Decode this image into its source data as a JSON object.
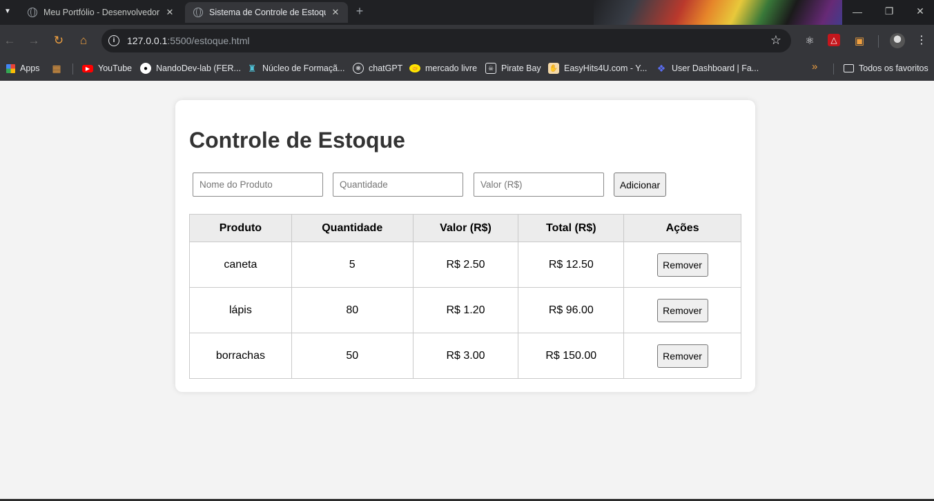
{
  "browser": {
    "tabs": [
      {
        "title": "Meu Portfólio - Desenvolvedor",
        "active": false
      },
      {
        "title": "Sistema de Controle de Estoque",
        "active": true
      }
    ],
    "url_host": "127.0.0.1",
    "url_rest": ":5500/estoque.html",
    "bookmarks": [
      {
        "label": "Apps",
        "icon": "apps-grid-icon"
      },
      {
        "label": "YouTube",
        "icon": "youtube-icon"
      },
      {
        "label": "NandoDev-lab (FER...",
        "icon": "github-icon"
      },
      {
        "label": "Núcleo de Formaçã...",
        "icon": "nucleo-icon"
      },
      {
        "label": "chatGPT",
        "icon": "chatgpt-icon"
      },
      {
        "label": "mercado livre",
        "icon": "mercadolivre-icon"
      },
      {
        "label": "Pirate Bay",
        "icon": "piratebay-icon"
      },
      {
        "label": "EasyHits4U.com - Y...",
        "icon": "easyhits-icon"
      },
      {
        "label": "User Dashboard | Fa...",
        "icon": "dashboard-icon"
      }
    ],
    "other_bookmarks": "Todos os favoritos"
  },
  "page": {
    "title": "Controle de Estoque",
    "form": {
      "name_placeholder": "Nome do Produto",
      "qty_placeholder": "Quantidade",
      "value_placeholder": "Valor (R$)",
      "add_label": "Adicionar"
    },
    "table": {
      "headers": [
        "Produto",
        "Quantidade",
        "Valor (R$)",
        "Total (R$)",
        "Ações"
      ],
      "rows": [
        {
          "produto": "caneta",
          "quantidade": "5",
          "valor": "R$ 2.50",
          "total": "R$ 12.50",
          "action": "Remover"
        },
        {
          "produto": "lápis",
          "quantidade": "80",
          "valor": "R$ 1.20",
          "total": "R$ 96.00",
          "action": "Remover"
        },
        {
          "produto": "borrachas",
          "quantidade": "50",
          "valor": "R$ 3.00",
          "total": "R$ 150.00",
          "action": "Remover"
        }
      ]
    }
  }
}
